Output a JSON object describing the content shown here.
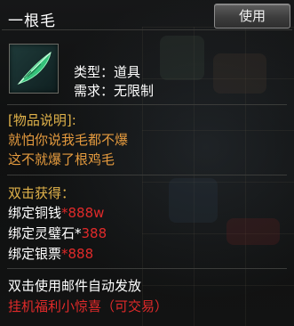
{
  "tooltip": {
    "title": "一根毛",
    "use_button": "使用",
    "item_icon": "green-feather-icon",
    "type_label": "类型：",
    "type_value": "道具",
    "req_label": "需求：",
    "req_value": "无限制",
    "desc_header": "[物品说明]:",
    "desc_lines": [
      "就怕你说我毛都不爆",
      "这不就爆了根鸡毛"
    ],
    "reward_header": "双击获得：",
    "rewards": [
      {
        "label": "绑定铜钱",
        "amount": "*888w"
      },
      {
        "label": "绑定灵璧石*",
        "amount": "388"
      },
      {
        "label": "绑定银票",
        "amount": "*888"
      }
    ],
    "footer_note": "双击使用邮件自动发放",
    "footer_highlight": "挂机福利小惊喜（可交易）"
  },
  "colors": {
    "title": "#ffffff",
    "section_header": "#e0b24a",
    "description": "#e49a3e",
    "highlight_red": "#e02a2a"
  }
}
